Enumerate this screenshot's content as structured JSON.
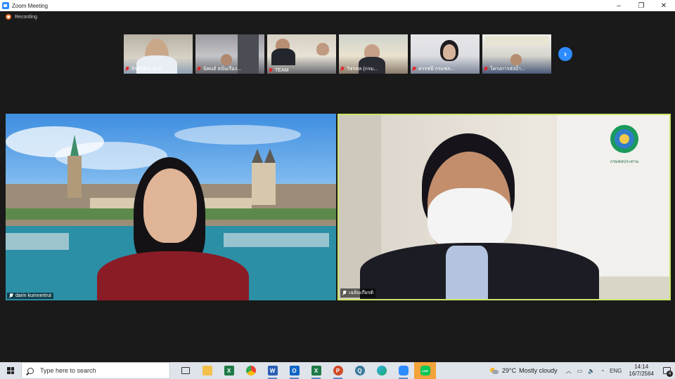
{
  "window": {
    "title": "Zoom Meeting",
    "controls": {
      "minimize": "–",
      "maximize": "❐",
      "close": "✕"
    }
  },
  "recording": {
    "label": "Recording",
    "color": "#f26d21"
  },
  "thumbnails": [
    {
      "name": "ถิรพิรัฒน์ สุกดิ...",
      "muted": true
    },
    {
      "name": "นิพนธ์ สนั่นเรือง...",
      "muted": true
    },
    {
      "name": "TEAM",
      "muted": true
    },
    {
      "name": "วิชรพล (กรม...",
      "muted": true
    },
    {
      "name": "ดรรชนี กรมชล...",
      "muted": true
    },
    {
      "name": "โครงการส่งน้ำ...",
      "muted": true
    }
  ],
  "next_page_icon": "chevron-right-icon",
  "main_videos": [
    {
      "name": "darin kumnertrut",
      "active_speaker": false
    },
    {
      "name": "เฉลิมเกียรติ",
      "active_speaker": true,
      "border_color": "#cbe66a"
    }
  ],
  "logo_caption": "กรมชลประทาน",
  "taskbar": {
    "search_placeholder": "Type here to search",
    "apps": [
      {
        "name": "task-view",
        "label": ""
      },
      {
        "name": "file-explorer",
        "label": ""
      },
      {
        "name": "excel",
        "label": "X"
      },
      {
        "name": "chrome",
        "label": ""
      },
      {
        "name": "word",
        "label": "W"
      },
      {
        "name": "outlook",
        "label": "O"
      },
      {
        "name": "excel-2",
        "label": "X"
      },
      {
        "name": "powerpoint",
        "label": "P"
      },
      {
        "name": "app-q",
        "label": "Q"
      },
      {
        "name": "edge",
        "label": ""
      },
      {
        "name": "zoom",
        "label": ""
      },
      {
        "name": "line",
        "label": "LINE"
      }
    ],
    "weather": {
      "temp": "29°C",
      "condition": "Mostly cloudy"
    },
    "language": "ENG",
    "time": "14:14",
    "date": "16/7/2564",
    "notification_count": "4"
  }
}
